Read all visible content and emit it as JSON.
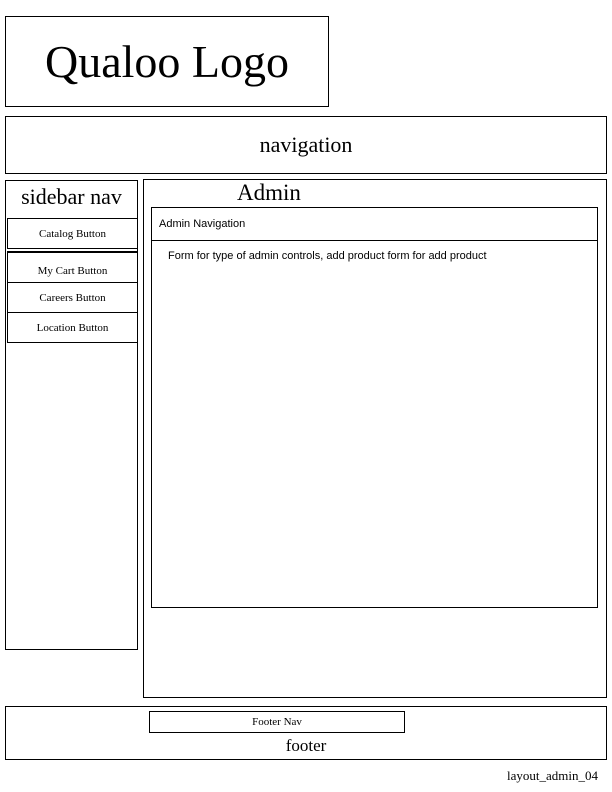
{
  "logo": {
    "text": "Qualoo Logo"
  },
  "navigation": {
    "label": "navigation"
  },
  "sidebar": {
    "title": "sidebar nav",
    "buttons": [
      {
        "label": "Catalog Button"
      },
      {
        "label": "My Cart Button"
      },
      {
        "label": "Careers Button"
      },
      {
        "label": "Location Button"
      }
    ]
  },
  "main": {
    "title": "Admin",
    "admin_navigation": "Admin Navigation",
    "form_text": "Form for type of admin controls, add product form for add product"
  },
  "footer": {
    "nav_label": "Footer Nav",
    "label": "footer"
  },
  "file_label": "layout_admin_04"
}
